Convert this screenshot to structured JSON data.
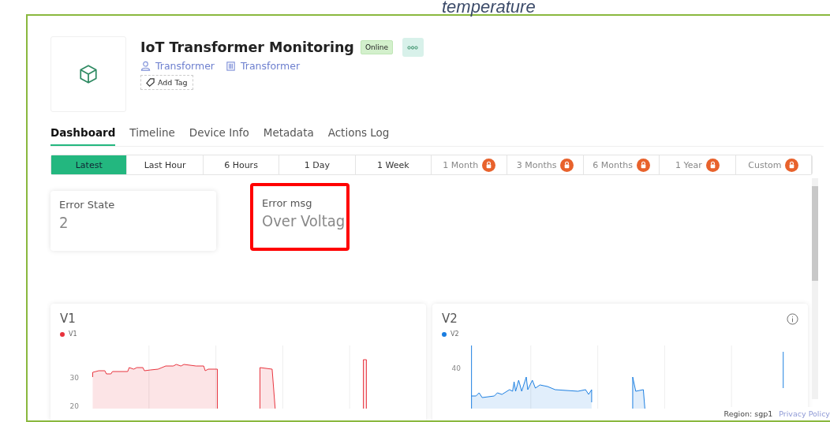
{
  "caption": "temperature",
  "device": {
    "title": "IoT Transformer Monitoring",
    "status": "Online",
    "owner": "Transformer",
    "organization": "Transformer",
    "add_tag": "Add Tag"
  },
  "tabs": [
    {
      "label": "Dashboard",
      "selected": true
    },
    {
      "label": "Timeline",
      "selected": false
    },
    {
      "label": "Device Info",
      "selected": false
    },
    {
      "label": "Metadata",
      "selected": false
    },
    {
      "label": "Actions Log",
      "selected": false
    }
  ],
  "time_ranges": [
    {
      "label": "Latest",
      "selected": true,
      "locked": false
    },
    {
      "label": "Last Hour",
      "selected": false,
      "locked": false
    },
    {
      "label": "6 Hours",
      "selected": false,
      "locked": false
    },
    {
      "label": "1 Day",
      "selected": false,
      "locked": false
    },
    {
      "label": "1 Week",
      "selected": false,
      "locked": false
    },
    {
      "label": "1 Month",
      "selected": false,
      "locked": true
    },
    {
      "label": "3 Months",
      "selected": false,
      "locked": true
    },
    {
      "label": "6 Months",
      "selected": false,
      "locked": true
    },
    {
      "label": "1 Year",
      "selected": false,
      "locked": true
    },
    {
      "label": "Custom",
      "selected": false,
      "locked": true
    }
  ],
  "widgets": [
    {
      "label": "Error State",
      "value": "2",
      "highlighted": false
    },
    {
      "label": "Error msg",
      "value": "Over Voltag",
      "highlighted": true
    }
  ],
  "charts": [
    {
      "title": "V1",
      "legend": "V1",
      "color": "#e8323c",
      "y_tick_labels": [
        "30",
        "20"
      ],
      "info": false
    },
    {
      "title": "V2",
      "legend": "V2",
      "color": "#1a7de0",
      "y_tick_labels": [
        "40"
      ],
      "info": true
    }
  ],
  "footer": {
    "region": "Region: sgp1",
    "privacy": "Privacy Policy"
  }
}
